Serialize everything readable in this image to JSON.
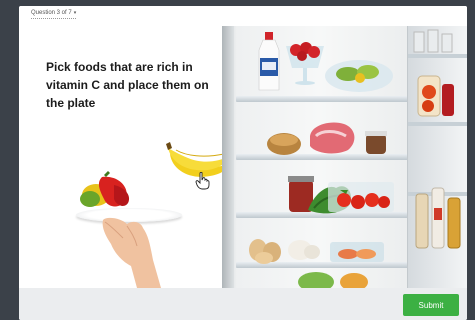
{
  "header": {
    "question_counter": "Question 3 of 7",
    "caret_icon": "caret-down-icon"
  },
  "main": {
    "instruction": "Pick foods that are rich in vitamin C and place them on the plate"
  },
  "footer": {
    "submit_label": "Submit"
  },
  "colors": {
    "background": "#3b4149",
    "card": "#ffffff",
    "footer": "#ebedef",
    "submit": "#3cb043"
  }
}
